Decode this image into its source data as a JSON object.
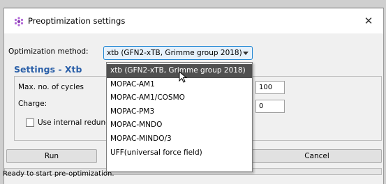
{
  "window": {
    "title": "Preoptimization settings",
    "close_glyph": "✕",
    "icon": "molecule-icon"
  },
  "method": {
    "label": "Optimization method:",
    "selected": "xtb (GFN2-xTB, Grimme group 2018)",
    "options": [
      "xtb (GFN2-xTB, Grimme group 2018)",
      "MOPAC-AM1",
      "MOPAC-AM1/COSMO",
      "MOPAC-PM3",
      "MOPAC-MNDO",
      "MOPAC-MINDO/3",
      "UFF(universal force field)"
    ]
  },
  "settings": {
    "title": "Settings - Xtb",
    "max_cycles_label": "Max. no. of cycles",
    "max_cycles_value": "100",
    "charge_label": "Charge:",
    "charge_value": "0",
    "redundant_label": "Use internal redund"
  },
  "buttons": {
    "run": "Run",
    "cancel": "Cancel"
  },
  "status": "Ready to start pre-optimization.",
  "colors": {
    "accent": "#1f86d3",
    "settings_title": "#2a5fa8",
    "selected_item_bg": "#505050"
  }
}
